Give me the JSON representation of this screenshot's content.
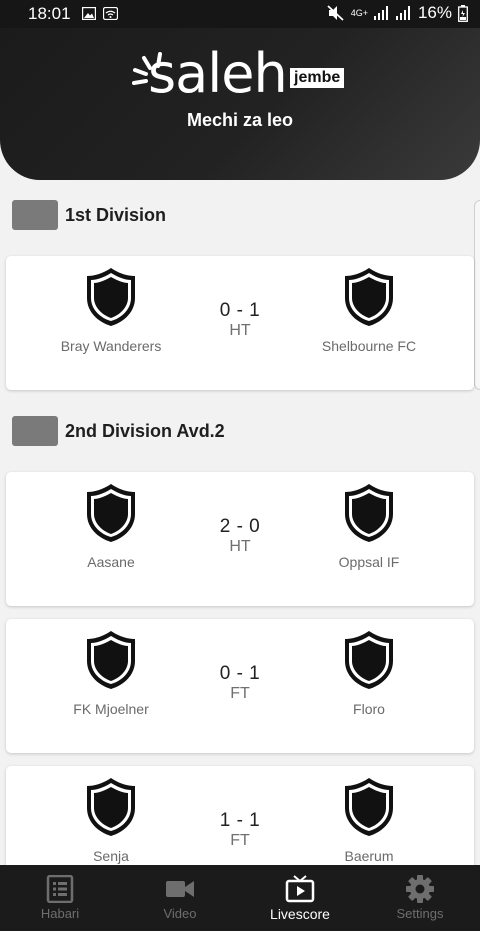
{
  "status_bar": {
    "time": "18:01",
    "battery_percent": "16%",
    "network": "4G+"
  },
  "header": {
    "logo_text": "saleh",
    "logo_badge": "jembe",
    "subtitle": "Mechi za leo"
  },
  "sections": [
    {
      "title": "1st Division",
      "matches": [
        {
          "home": "Bray Wanderers",
          "away": "Shelbourne FC",
          "score": "0 - 1",
          "status": "HT"
        }
      ]
    },
    {
      "title": "2nd Division Avd.2",
      "matches": [
        {
          "home": "Aasane",
          "away": "Oppsal IF",
          "score": "2 - 0",
          "status": "HT"
        },
        {
          "home": "FK Mjoelner",
          "away": "Floro",
          "score": "0 - 1",
          "status": "FT"
        },
        {
          "home": "Senja",
          "away": "Baerum",
          "score": "1 - 1",
          "status": "FT"
        }
      ]
    }
  ],
  "bottom_nav": {
    "items": [
      {
        "label": "Habari",
        "icon": "news-icon"
      },
      {
        "label": "Video",
        "icon": "video-camera-icon"
      },
      {
        "label": "Livescore",
        "icon": "tv-play-icon"
      },
      {
        "label": "Settings",
        "icon": "gear-icon"
      }
    ],
    "active_index": 2
  },
  "colors": {
    "header_bg": "#1b1b1b",
    "nav_bg": "#1b1b1b",
    "card_bg": "#ffffff",
    "page_bg": "#f2f2f2",
    "section_flag": "#7a7a7a"
  }
}
